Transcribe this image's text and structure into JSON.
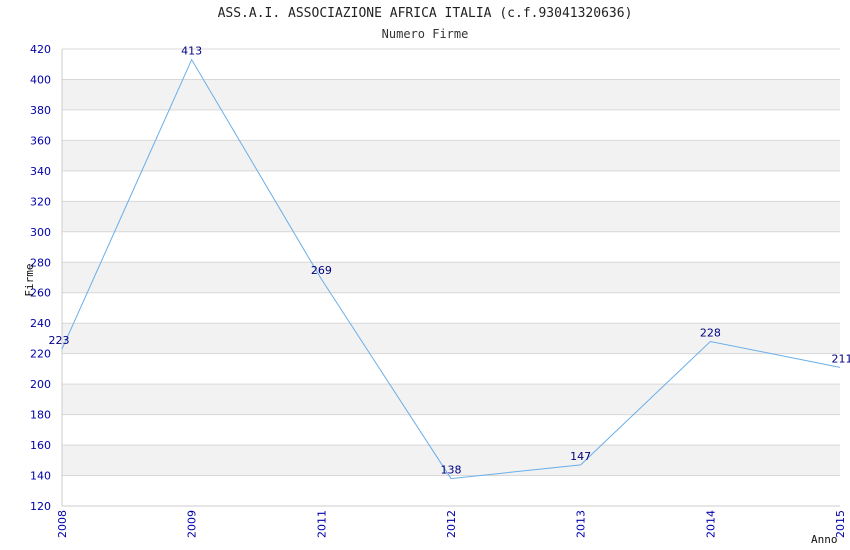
{
  "chart_data": {
    "type": "line",
    "title": "ASS.A.I. ASSOCIAZIONE AFRICA ITALIA (c.f.93041320636)",
    "subtitle": "Numero Firme",
    "xlabel": "Anno",
    "ylabel": "Firme",
    "x": [
      "2008",
      "2009",
      "2011",
      "2012",
      "2013",
      "2014",
      "2015"
    ],
    "values": [
      223,
      413,
      269,
      138,
      147,
      228,
      211
    ],
    "ylim": [
      120,
      420
    ],
    "ytick_step": 20,
    "grid": true,
    "legend": "none",
    "colors": {
      "line": "#6aaee8",
      "band": "#f2f2f2",
      "gridline": "#d8d8d8",
      "tick_text": "#0000aa",
      "label_text": "#000080"
    }
  }
}
